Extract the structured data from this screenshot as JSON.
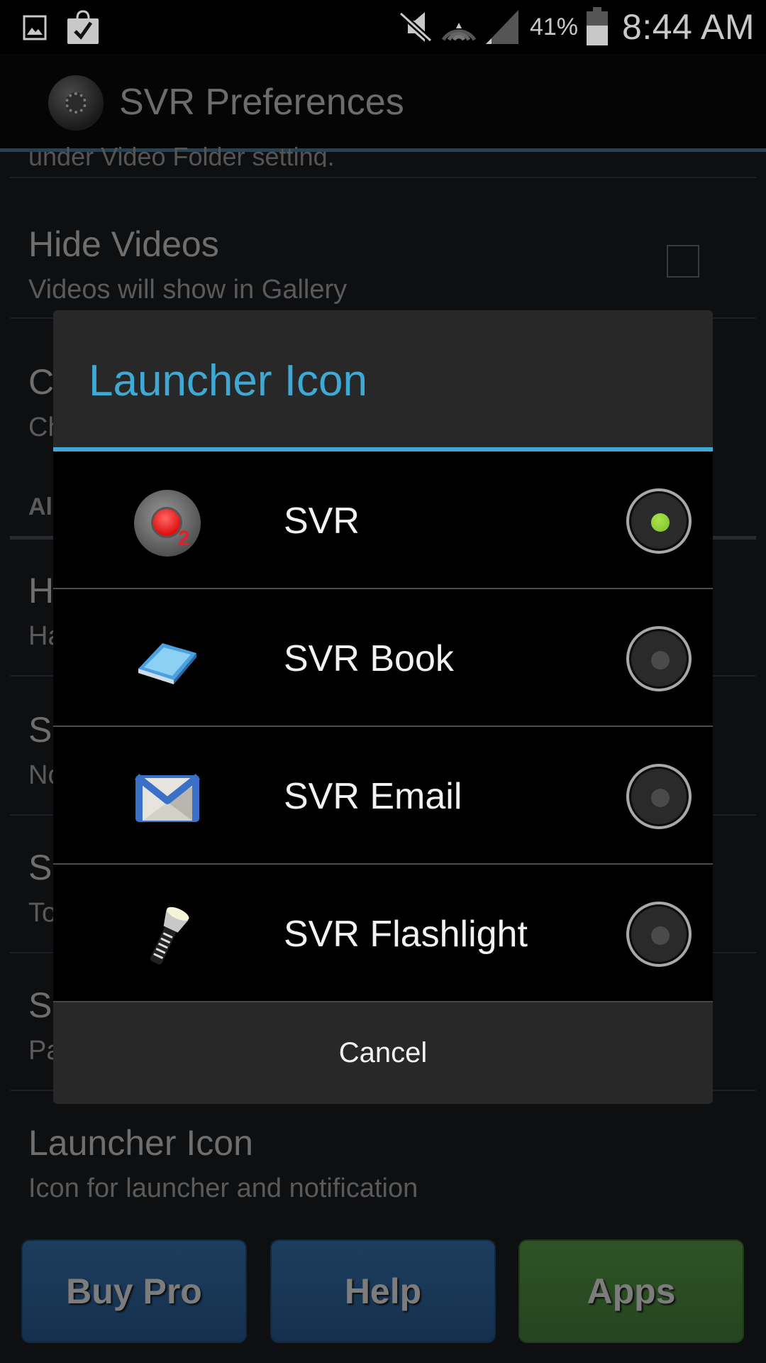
{
  "status_bar": {
    "left_icons": [
      "gallery-icon",
      "shopping-bag-check-icon"
    ],
    "right_icons": [
      "mute-icon",
      "wifi-icon",
      "signal-icon",
      "battery-icon"
    ],
    "battery_percent": "41%",
    "time": "8:44 AM"
  },
  "app": {
    "title": "SVR Preferences",
    "logo_icon": "settings-gear-icon"
  },
  "preferences": {
    "clipped_summary": "under Video Folder setting.",
    "items": [
      {
        "title": "Hide Videos",
        "summary": "Videos will show in Gallery",
        "checked": false
      },
      {
        "title": "C",
        "summary": "Ch"
      },
      {
        "category": "Al"
      },
      {
        "title": "H",
        "summary": "Ha"
      },
      {
        "title": "S",
        "summary": "No"
      },
      {
        "title": "S",
        "summary": "To"
      },
      {
        "title": "S",
        "summary": "Pa"
      },
      {
        "title": "Launcher Icon",
        "summary": "Icon for launcher and notification"
      }
    ]
  },
  "bottom_buttons": {
    "buy_pro": "Buy Pro",
    "help": "Help",
    "apps": "Apps"
  },
  "dialog": {
    "title": "Launcher Icon",
    "accent_color": "#3fa9d5",
    "options": [
      {
        "label": "SVR",
        "icon": "record-icon",
        "selected": true
      },
      {
        "label": "SVR Book",
        "icon": "book-icon",
        "selected": false
      },
      {
        "label": "SVR Email",
        "icon": "email-icon",
        "selected": false
      },
      {
        "label": "SVR Flashlight",
        "icon": "flashlight-icon",
        "selected": false
      }
    ],
    "cancel_label": "Cancel"
  }
}
